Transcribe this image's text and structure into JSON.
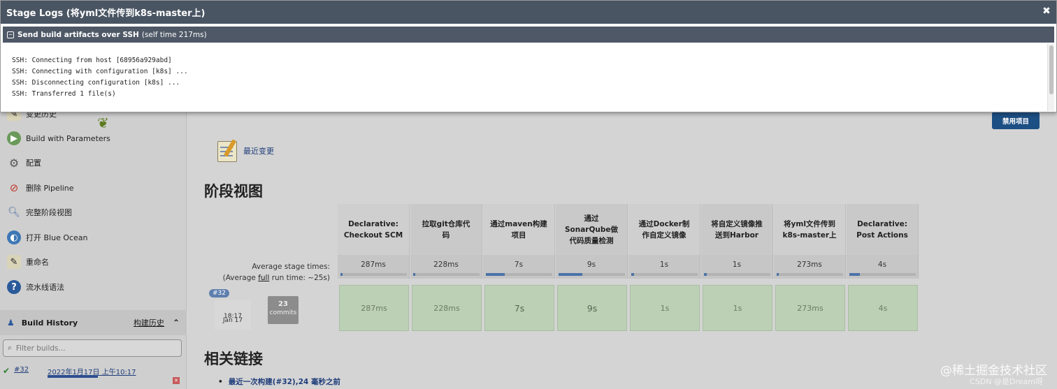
{
  "modal": {
    "title": "Stage Logs (将yml文件传到k8s-master上)",
    "close": "✖",
    "step_name": "Send build artifacts over SSH",
    "step_time": "(self time 217ms)",
    "log_lines": [
      "SSH: Connecting from host [68956a929abd]",
      "SSH: Connecting with configuration [k8s] ...",
      "SSH: Disconnecting configuration [k8s] ...",
      "SSH: Transferred 1 file(s)"
    ]
  },
  "sidebar": {
    "items": [
      {
        "label": "变更历史",
        "icon": "notepad-icon"
      },
      {
        "label": "Build with Parameters",
        "icon": "build-icon"
      },
      {
        "label": "配置",
        "icon": "gear-icon"
      },
      {
        "label": "删除 Pipeline",
        "icon": "no-entry-icon"
      },
      {
        "label": "完整阶段视图",
        "icon": "magnifier-icon"
      },
      {
        "label": "打开 Blue Ocean",
        "icon": "ocean-icon"
      },
      {
        "label": "重命名",
        "icon": "notepad-icon"
      },
      {
        "label": "流水线语法",
        "icon": "help-icon"
      }
    ],
    "build_history": {
      "title": "Build History",
      "title_cn": "构建历史",
      "chevron": "⌃"
    },
    "filter_placeholder": "Filter builds...",
    "history": [
      {
        "number": "#32",
        "date": "2022年1月17日 上午10:17"
      }
    ]
  },
  "main": {
    "disable_button": "禁用项目",
    "recent_changes": "最近变更",
    "stage_view_title": "阶段视图",
    "avg_label": "Average stage times:",
    "avg_run_prefix": "(Average ",
    "avg_run_link": "full",
    "avg_run_suffix": " run time: ~25s)",
    "build": {
      "tag": "#32",
      "date": "Jan 17",
      "time": "18:17",
      "commits_count": "23",
      "commits_label": "commits"
    },
    "stages": [
      {
        "name": "Declarative:\nCheckout SCM",
        "avg": "287ms",
        "run": "287ms",
        "progress": 0.02
      },
      {
        "name": "拉取git仓库代\n码",
        "avg": "228ms",
        "run": "228ms",
        "progress": 0.02
      },
      {
        "name": "通过maven构建\n项目",
        "avg": "7s",
        "run": "7s",
        "progress": 0.28
      },
      {
        "name": "通过\nSonarQube做\n代码质量检测",
        "avg": "9s",
        "run": "9s",
        "progress": 0.36
      },
      {
        "name": "通过Docker制\n作自定义镜像",
        "avg": "1s",
        "run": "1s",
        "progress": 0.04
      },
      {
        "name": "将自定义镜像推\n送到Harbor",
        "avg": "1s",
        "run": "1s",
        "progress": 0.04
      },
      {
        "name": "将yml文件传到\nk8s-master上",
        "avg": "273ms",
        "run": "273ms",
        "progress": 0.02
      },
      {
        "name": "Declarative:\nPost Actions",
        "avg": "4s",
        "run": "4s",
        "progress": 0.16
      }
    ],
    "links_title": "相关链接",
    "links": [
      "最近一次构建(#32),24 毫秒之前"
    ]
  },
  "watermark": {
    "line1": "@稀土掘金技术社区",
    "line2": "CSDN @是Dream呀"
  }
}
